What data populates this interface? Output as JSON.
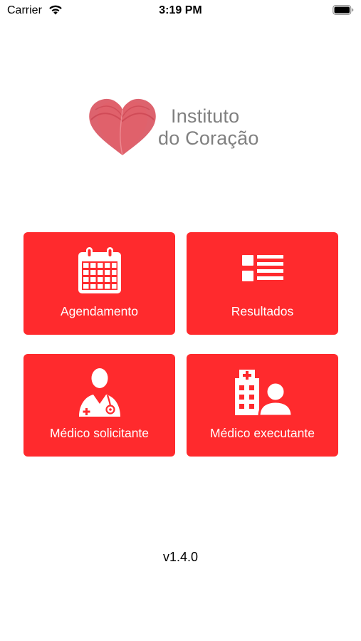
{
  "status_bar": {
    "carrier": "Carrier",
    "time": "3:19 PM",
    "wifi_icon": "wifi-icon",
    "battery_icon": "battery-icon"
  },
  "logo": {
    "line1": "Instituto",
    "line2": "do Coração",
    "icon": "heart-logo-icon",
    "text_color": "#808080",
    "heart_color": "#d9525e"
  },
  "menu": {
    "accent_color": "#ff2a2d",
    "items": [
      {
        "label": "Agendamento",
        "icon": "calendar-icon"
      },
      {
        "label": "Resultados",
        "icon": "list-icon"
      },
      {
        "label": "Médico solicitante",
        "icon": "doctor-icon"
      },
      {
        "label": "Médico executante",
        "icon": "hospital-user-icon"
      }
    ]
  },
  "footer": {
    "version": "v1.4.0"
  }
}
